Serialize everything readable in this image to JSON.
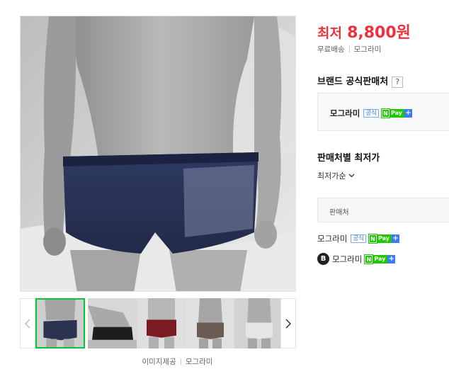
{
  "product": {
    "price_label": "최저",
    "price_value": "8,800원",
    "shipping": "무료배송",
    "shipping_seller": "모그라미"
  },
  "brand_store": {
    "heading": "브랜드 공식판매처",
    "help": "?",
    "seller_name": "모그라미",
    "official_badge": "공식",
    "npay_n": "N",
    "npay_pay": "Pay",
    "npay_plus": "+"
  },
  "sellers": {
    "heading": "판매처별 최저가",
    "sort_label": "최저가순",
    "table_header": "판매처",
    "rows": [
      {
        "name": "모그라미",
        "official_badge": "공식",
        "npay_n": "N",
        "npay_pay": "Pay",
        "npay_plus": "+"
      },
      {
        "icon": "B",
        "name": "모그라미",
        "npay_n": "N",
        "npay_pay": "Pay",
        "npay_plus": "+"
      }
    ]
  },
  "gallery": {
    "thumbnail_colors": [
      "#2b3350",
      "#1d1d1d",
      "#7a1a23",
      "#6b5a52",
      "#e6e6e6"
    ],
    "active_index": 0,
    "credit_label": "이미지제공",
    "credit_source": "모그라미"
  },
  "colors": {
    "price": "#f0303c",
    "active_thumb_border": "#00c73c",
    "npay_green": "#1ec800",
    "official_blue": "#3f83e4"
  }
}
